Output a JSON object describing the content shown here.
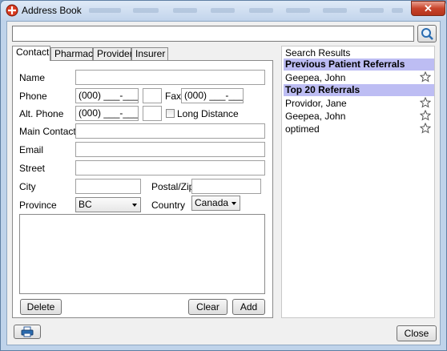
{
  "window": {
    "title": "Address Book",
    "close_glyph": "✕"
  },
  "search": {
    "value": "",
    "button_icon": "search-icon"
  },
  "tabs": [
    {
      "label": "Contact",
      "active": true
    },
    {
      "label": "Pharmacy",
      "active": false
    },
    {
      "label": "Provider",
      "active": false
    },
    {
      "label": "Insurer",
      "active": false
    }
  ],
  "form": {
    "name_label": "Name",
    "name_value": "",
    "phone_label": "Phone",
    "phone_value": "(000) ___-____",
    "phone_ext": "",
    "fax_label": "Fax",
    "fax_value": "(000) ___-____",
    "alt_phone_label": "Alt. Phone",
    "alt_phone_value": "(000) ___-____",
    "alt_phone_ext": "",
    "long_distance_label": "Long Distance",
    "long_distance_checked": false,
    "main_contact_label": "Main Contact",
    "main_contact_value": "",
    "email_label": "Email",
    "email_value": "",
    "street_label": "Street",
    "street_value": "",
    "city_label": "City",
    "city_value": "",
    "postal_label": "Postal/Zip",
    "postal_value": "",
    "province_label": "Province",
    "province_value": "BC",
    "country_label": "Country",
    "country_value": "Canada",
    "notes_value": ""
  },
  "buttons": {
    "delete": "Delete",
    "clear": "Clear",
    "add": "Add",
    "close": "Close",
    "print_icon": "printer-icon"
  },
  "results": {
    "title": "Search Results",
    "groups": [
      {
        "label": "Previous Patient Referrals",
        "items": [
          {
            "name": "Geepea, John",
            "starred": false
          }
        ]
      },
      {
        "label": "Top 20 Referrals",
        "items": [
          {
            "name": "Providor, Jane",
            "starred": false
          },
          {
            "name": "Geepea, John",
            "starred": false
          },
          {
            "name": "optimed",
            "starred": false
          }
        ]
      }
    ]
  },
  "colors": {
    "group_header_bg": "#bdbdf3",
    "titlebar_close": "#c8442b",
    "frame": "#bfd3ea"
  }
}
